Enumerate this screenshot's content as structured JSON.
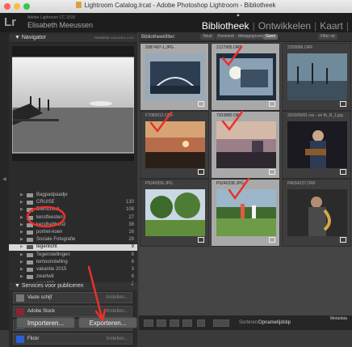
{
  "window": {
    "title": "Lightroom Catalog.lrcat - Adobe Photoshop Lightroom - Bibliotheek",
    "controls": [
      "close",
      "minimize",
      "zoom"
    ],
    "control_colors": [
      "#fc605b",
      "#fdbc40",
      "#34c84a"
    ]
  },
  "header": {
    "logo": "Lr",
    "version": "Adobe Lightroom CC 2015",
    "user": "Elisabeth Meeussen",
    "modules": [
      "Bibliotheek",
      "Ontwikkelen",
      "Kaart",
      "|"
    ],
    "active_module": "Bibliotheek"
  },
  "navigator": {
    "title": "Navigator",
    "options": "PASSEND  VULLEN  1:1  4:1"
  },
  "folders": [
    {
      "label": "Bagpadpaadje",
      "count": ""
    },
    {
      "label": "CRUISE",
      "count": "130"
    },
    {
      "label": "Dierschool",
      "count": "108"
    },
    {
      "label": "kerstfeesten",
      "count": "27"
    },
    {
      "label": "kersthebben2",
      "count": "38"
    },
    {
      "label": "portret-koen",
      "count": "16"
    },
    {
      "label": "Sociale Fotografie",
      "count": "28"
    },
    {
      "label": "tegenlicht",
      "count": "9"
    },
    {
      "label": "Tegenstellingen",
      "count": "8"
    },
    {
      "label": "tentoonstelling",
      "count": "6"
    },
    {
      "label": "vakantie 2015",
      "count": "3"
    },
    {
      "label": "zwartwit",
      "count": "6"
    },
    {
      "label": "paard10",
      "count": "1"
    }
  ],
  "selected_folder": "tegenlicht",
  "services": {
    "title": "Services voor publiceren",
    "action_label": "Instellen...",
    "items": [
      {
        "label": "Vaste schijf",
        "icon": "hard-drive-icon",
        "color": "#777777"
      },
      {
        "label": "Adobe Stock",
        "icon": "adobe-stock-icon",
        "color": "#8a2433"
      },
      {
        "label": "Facebook",
        "icon": "facebook-icon",
        "color": "#3b5998"
      },
      {
        "label": "Flickr",
        "icon": "flickr-icon",
        "color": "#2a5fd6"
      }
    ]
  },
  "buttons": {
    "import": "Importeren...",
    "export": "Exporteren..."
  },
  "filter_bar": {
    "title": "Bibliotheekfilter:",
    "options": [
      "Tekst",
      "Kenmerk",
      "Metagegevens",
      "Geen"
    ],
    "active": "Geen",
    "preset": "Filter uit"
  },
  "grid": {
    "cells": [
      {
        "filename": "2087497-1.JPG",
        "tone": "light",
        "scene": "night-building"
      },
      {
        "filename": "2127905.ORF",
        "tone": "light",
        "scene": "lamp"
      },
      {
        "filename": "2258886.ORF",
        "tone": "dark",
        "scene": "harbor"
      },
      {
        "filename": "F7083012.ORF",
        "tone": "dark",
        "scene": "sunset"
      },
      {
        "filename": "7203880.ORF",
        "tone": "light",
        "scene": "dusk"
      },
      {
        "filename": "2016/09/01 res - en fb_R_1.jpg",
        "tone": "dark",
        "scene": "guitarist"
      },
      {
        "filename": "P9240099.JPG",
        "tone": "dark",
        "scene": "park"
      },
      {
        "filename": "P9240238.JPG",
        "tone": "light",
        "scene": "golf"
      },
      {
        "filename": "PA054237.ORF",
        "tone": "dark",
        "scene": "saxophone"
      }
    ]
  },
  "toolbar": {
    "sort_label": "Sorteren:",
    "sort_value": "Opnametijdstip",
    "metadata_label": "Metadata"
  },
  "annotation_color": "#e8322a"
}
